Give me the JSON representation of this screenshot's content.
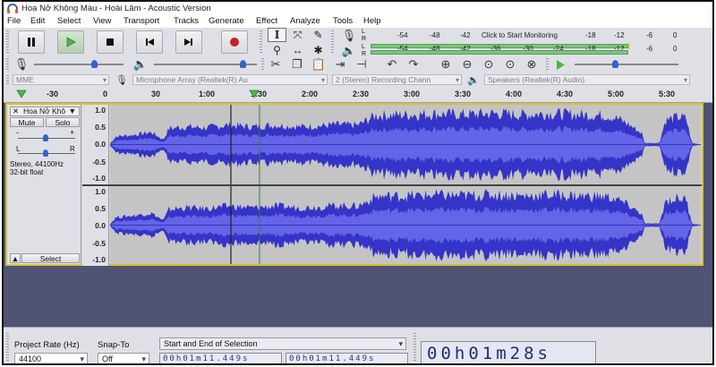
{
  "window": {
    "title": "Hoa Nở Không Màu - Hoài Lâm - Acoustic Version"
  },
  "menu": [
    "File",
    "Edit",
    "Select",
    "View",
    "Transport",
    "Tracks",
    "Generate",
    "Effect",
    "Analyze",
    "Tools",
    "Help"
  ],
  "transport": {
    "pause": "pause-icon",
    "play": "play-icon",
    "stop": "stop-icon",
    "skip_start": "skip-start-icon",
    "skip_end": "skip-end-icon",
    "record": "record-icon"
  },
  "meters": {
    "record_scale": [
      "-54",
      "-48",
      "-42",
      "Click to Start Monitoring",
      "-18",
      "-12",
      "-6",
      "0"
    ],
    "play_scale": [
      "-54",
      "-48",
      "-42",
      "-36",
      "-30",
      "-24",
      "-18",
      "-12",
      "-6",
      "0"
    ],
    "channels": [
      "L",
      "R"
    ]
  },
  "devices": {
    "host": "MME",
    "input": "Microphone Array (Realtek(R) Au",
    "channels": "2 (Stereo) Recording Chann",
    "output": "Speakers (Realtek(R) Audio)"
  },
  "timeline": {
    "ticks": [
      "-30",
      "0",
      "30",
      "1:00",
      "1:30",
      "2:00",
      "2:30",
      "3:00",
      "3:30",
      "4:00",
      "4:30",
      "5:00",
      "5:30"
    ]
  },
  "track": {
    "name": "Hoa Nở Khô",
    "mute": "Mute",
    "solo": "Solo",
    "gain_min": "-",
    "gain_max": "+",
    "pan_left": "L",
    "pan_right": "R",
    "info_rate": "Stereo, 44100Hz",
    "info_format": "32-bit float",
    "select": "Select",
    "scale": [
      "1.0",
      "0.5",
      "0.0",
      "-0.5",
      "-1.0"
    ]
  },
  "selection": {
    "project_rate_label": "Project Rate (Hz)",
    "project_rate": "44100",
    "snap_label": "Snap-To",
    "snap": "Off",
    "mode": "Start and End of Selection",
    "start": "00h01m11.449s",
    "end": "00h01m11.449s",
    "position": "00h01m28s"
  },
  "colors": {
    "waveform": "#3434c8",
    "track_bg": "#4f5474",
    "focus_border": "#d7c335",
    "meter_green": "#7cc47b"
  }
}
